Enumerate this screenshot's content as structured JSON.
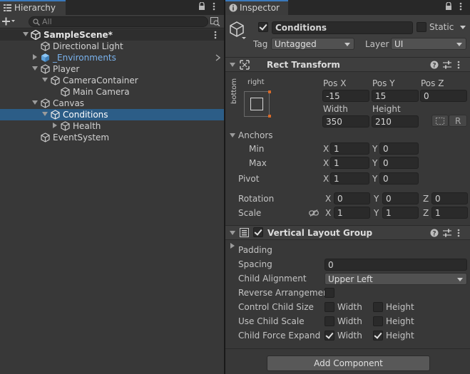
{
  "hierarchy": {
    "tab_label": "Hierarchy",
    "search_placeholder": "All",
    "scene_name": "SampleScene*",
    "items": [
      {
        "label": "Directional Light"
      },
      {
        "label": "_Environments"
      },
      {
        "label": "Player"
      },
      {
        "label": "CameraContainer"
      },
      {
        "label": "Main Camera"
      },
      {
        "label": "Canvas"
      },
      {
        "label": "Conditions"
      },
      {
        "label": "Health"
      },
      {
        "label": "EventSystem"
      }
    ]
  },
  "inspector": {
    "tab_label": "Inspector",
    "object_name": "Conditions",
    "static_label": "Static",
    "tag_label": "Tag",
    "tag_value": "Untagged",
    "layer_label": "Layer",
    "layer_value": "UI",
    "rect_transform": {
      "title": "Rect Transform",
      "anchor_h": "right",
      "anchor_v": "bottom",
      "pos_x_label": "Pos X",
      "pos_y_label": "Pos Y",
      "pos_z_label": "Pos Z",
      "pos_x": "-15",
      "pos_y": "15",
      "pos_z": "0",
      "width_label": "Width",
      "height_label": "Height",
      "width": "350",
      "height": "210",
      "r_button": "R",
      "anchors_label": "Anchors",
      "min_label": "Min",
      "max_label": "Max",
      "min_x": "1",
      "min_y": "0",
      "max_x": "1",
      "max_y": "0",
      "pivot_label": "Pivot",
      "pivot_x": "1",
      "pivot_y": "0",
      "rotation_label": "Rotation",
      "rot_x": "0",
      "rot_y": "0",
      "rot_z": "0",
      "scale_label": "Scale",
      "scale_x": "1",
      "scale_y": "1",
      "scale_z": "1",
      "x": "X",
      "y": "Y",
      "z": "Z"
    },
    "vlg": {
      "title": "Vertical Layout Group",
      "padding_label": "Padding",
      "spacing_label": "Spacing",
      "spacing": "0",
      "child_alignment_label": "Child Alignment",
      "child_alignment": "Upper Left",
      "reverse_label": "Reverse Arrangement",
      "control_size_label": "Control Child Size",
      "use_scale_label": "Use Child Scale",
      "force_expand_label": "Child Force Expand",
      "width_label": "Width",
      "height_label": "Height",
      "control_size_width": false,
      "control_size_height": false,
      "use_scale_width": false,
      "use_scale_height": false,
      "force_expand_width": true,
      "force_expand_height": true
    },
    "add_component": "Add Component"
  },
  "colors": {
    "selection": "#2c5d87",
    "tab_accent": "#3a79bb",
    "prefab_blue": "#7ab3ee"
  }
}
